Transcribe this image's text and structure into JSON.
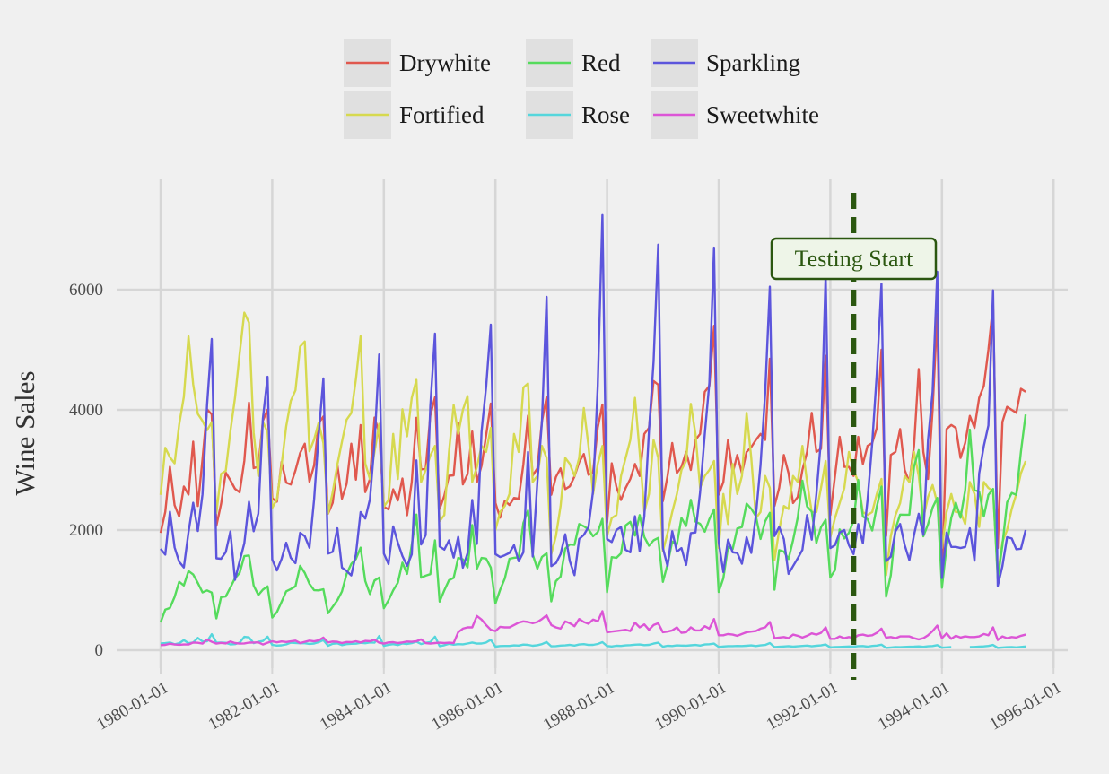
{
  "chart_data": {
    "type": "line",
    "title": "",
    "xlabel": "",
    "ylabel": "Wine Sales",
    "x_start": "1980-01-01",
    "frequency": "monthly",
    "xlim": [
      "1979-02-01",
      "1996-04-01"
    ],
    "ylim": [
      -300,
      7800
    ],
    "grid": true,
    "legend_position": "top",
    "x_ticks": [
      "1980-01-01",
      "1982-01-01",
      "1984-01-01",
      "1986-01-01",
      "1988-01-01",
      "1990-01-01",
      "1992-01-01",
      "1994-01-01",
      "1996-01-01"
    ],
    "y_ticks": [
      "0",
      "2000",
      "4000",
      "6000"
    ],
    "annotation": {
      "label": "Testing Start",
      "x": "1992-06-01",
      "style": "dashed vertical line"
    },
    "series": [
      {
        "name": "Drywhite",
        "color": "#e0584e",
        "values": [
          1954,
          2302,
          3054,
          2414,
          2226,
          2725,
          2589,
          3470,
          2400,
          3180,
          4009,
          3924,
          2072,
          2434,
          2956,
          2828,
          2687,
          2629,
          3150,
          4119,
          3030,
          3055,
          3821,
          4001,
          2529,
          2472,
          3134,
          2789,
          2758,
          2993,
          3282,
          3437,
          2804,
          3076,
          3782,
          3889,
          2271,
          2452,
          3084,
          2522,
          2769,
          3438,
          2839,
          3746,
          2632,
          2851,
          3871,
          3618,
          2389,
          2344,
          2678,
          2492,
          2858,
          2246,
          2800,
          3869,
          3007,
          3023,
          3907,
          4209,
          2353,
          2570,
          2903,
          2910,
          3782,
          2759,
          2931,
          3641,
          2794,
          3070,
          3576,
          4106,
          2452,
          2206,
          2488,
          2416,
          2534,
          2521,
          3093,
          3903,
          2907,
          3025,
          3812,
          4209,
          2587,
          2883,
          3027,
          2680,
          2729,
          2892,
          3131,
          3265,
          2919,
          2961,
          3705,
          4088,
          2120,
          3110,
          2720,
          2500,
          2700,
          2850,
          3100,
          2900,
          3600,
          3700,
          4480,
          4420,
          2480,
          2900,
          3450,
          2950,
          3050,
          3300,
          3000,
          3500,
          3600,
          4300,
          4400,
          5400,
          2590,
          2800,
          3500,
          2950,
          3250,
          2950,
          3300,
          3380,
          3500,
          3600,
          3500,
          4850,
          2400,
          2700,
          3250,
          2950,
          2450,
          2550,
          3000,
          3300,
          3950,
          3300,
          3350,
          4900,
          2250,
          2900,
          3550,
          3050,
          3050,
          2900,
          3550,
          3100,
          3400,
          3450,
          3700,
          5000,
          1900,
          3250,
          3300,
          3680,
          3000,
          2800,
          3400,
          4680,
          3300,
          2850,
          4000,
          5600,
          1200,
          3680,
          3750,
          3700,
          3200,
          3450,
          3900,
          3700,
          4200,
          4400,
          5000,
          5750,
          1700,
          3800,
          4050,
          4000,
          3950,
          4350,
          4300
        ]
      },
      {
        "name": "Fortified",
        "color": "#d6d94f",
        "values": [
          2585,
          3368,
          3210,
          3111,
          3756,
          4216,
          5225,
          4426,
          3932,
          3816,
          3661,
          3795,
          2285,
          2934,
          2985,
          3646,
          4198,
          4935,
          5618,
          5454,
          3624,
          2898,
          3802,
          3629,
          2369,
          2511,
          3079,
          3728,
          4151,
          4326,
          5054,
          5138,
          3310,
          3508,
          3790,
          3446,
          2275,
          2630,
          3089,
          3468,
          3837,
          3946,
          4514,
          5226,
          3110,
          2846,
          3300,
          3767,
          2388,
          2500,
          3600,
          2850,
          4010,
          3560,
          4200,
          4500,
          2800,
          3000,
          3240,
          3400,
          2150,
          2250,
          3300,
          4080,
          3600,
          4000,
          4230,
          2800,
          3050,
          3400,
          3300,
          3700,
          2000,
          2300,
          2400,
          2600,
          3600,
          3300,
          4370,
          4440,
          2800,
          2900,
          3400,
          3200,
          1600,
          1900,
          2400,
          3200,
          3100,
          2900,
          3200,
          4030,
          3400,
          2600,
          3100,
          3400,
          1900,
          2200,
          2250,
          2900,
          3200,
          3500,
          4200,
          3300,
          2300,
          2600,
          3500,
          3200,
          1650,
          1950,
          2300,
          2600,
          3000,
          3150,
          4100,
          3600,
          2700,
          2900,
          3000,
          3150,
          1700,
          2600,
          2100,
          3100,
          2600,
          2900,
          3950,
          3200,
          2200,
          2300,
          2900,
          2700,
          1500,
          2000,
          2400,
          2350,
          2900,
          2800,
          3400,
          2800,
          2300,
          2300,
          2700,
          3150,
          1880,
          2200,
          2450,
          2700,
          3300,
          3000,
          2800,
          2300,
          2250,
          2300,
          2600,
          2850,
          1250,
          1900,
          2250,
          2450,
          2900,
          2800,
          3300,
          2900,
          2200,
          2550,
          2750,
          2450,
          1700,
          2300,
          2600,
          2300,
          2300,
          2100,
          2800,
          2600,
          2050,
          2800,
          2700,
          2650,
          1250,
          1800,
          2000,
          2350,
          2600,
          2950,
          3150
        ]
      },
      {
        "name": "Red",
        "color": "#55db5c",
        "values": [
          464,
          675,
          703,
          887,
          1139,
          1077,
          1318,
          1260,
          1120,
          963,
          996,
          960,
          530,
          883,
          894,
          1045,
          1199,
          1287,
          1565,
          1577,
          1076,
          918,
          1008,
          1063,
          544,
          635,
          804,
          980,
          1018,
          1064,
          1404,
          1286,
          1104,
          999,
          996,
          1015,
          615,
          722,
          832,
          977,
          1270,
          1437,
          1520,
          1708,
          1151,
          934,
          1159,
          1209,
          699,
          830,
          996,
          1124,
          1458,
          1270,
          1753,
          2258,
          1208,
          1241,
          1265,
          1828,
          809,
          997,
          1164,
          1205,
          1538,
          1513,
          1378,
          2083,
          1357,
          1536,
          1526,
          1376,
          779,
          1005,
          1193,
          1522,
          1539,
          1546,
          2116,
          2326,
          1596,
          1356,
          1553,
          1613,
          814,
          1150,
          1225,
          1691,
          1759,
          1754,
          2100,
          2062,
          2012,
          1897,
          1964,
          2186,
          966,
          1549,
          1538,
          1612,
          2078,
          2137,
          1907,
          2249,
          1883,
          1739,
          1828,
          1868,
          1138,
          1430,
          1809,
          1763,
          2200,
          2067,
          2503,
          2141,
          2103,
          1972,
          2181,
          2344,
          970,
          1199,
          1718,
          1683,
          2025,
          2051,
          2439,
          2353,
          2230,
          1852,
          2147,
          2286,
          1007,
          1665,
          1642,
          1518,
          1831,
          2207,
          2822,
          2393,
          2306,
          1785,
          2047,
          2171,
          1212,
          1335,
          2011,
          1860,
          1954,
          2152,
          2835,
          2224,
          2182,
          1992,
          2389,
          2724,
          891,
          1247,
          2017,
          2257,
          2255,
          2255,
          3057,
          3330,
          1896,
          2096,
          2374,
          2535,
          1041,
          1728,
          2201,
          2455,
          2204,
          2660,
          3670,
          2665,
          2639,
          2226,
          2586,
          2684,
          1185,
          1749,
          2459,
          2618,
          2585,
          3310,
          3923
        ]
      },
      {
        "name": "Rose",
        "color": "#55d6dc",
        "values": [
          112,
          118,
          129,
          99,
          116,
          168,
          118,
          129,
          205,
          147,
          150,
          267,
          126,
          129,
          124,
          97,
          102,
          127,
          222,
          214,
          118,
          141,
          154,
          226,
          89,
          77,
          82,
          97,
          127,
          121,
          117,
          117,
          106,
          112,
          134,
          169,
          75,
          108,
          115,
          85,
          101,
          108,
          109,
          124,
          116,
          130,
          125,
          236,
          73,
          89,
          101,
          86,
          114,
          104,
          118,
          143,
          103,
          124,
          135,
          225,
          69,
          83,
          107,
          93,
          101,
          98,
          112,
          128,
          111,
          112,
          129,
          174,
          60,
          70,
          72,
          72,
          80,
          77,
          94,
          90,
          75,
          84,
          101,
          136,
          65,
          68,
          78,
          80,
          90,
          78,
          95,
          102,
          88,
          90,
          105,
          135,
          70,
          62,
          75,
          72,
          80,
          85,
          92,
          96,
          85,
          90,
          110,
          125,
          58,
          75,
          70,
          80,
          78,
          76,
          82,
          88,
          78,
          95,
          100,
          110,
          55,
          62,
          68,
          68,
          72,
          70,
          74,
          80,
          70,
          80,
          88,
          120,
          52,
          58,
          62,
          68,
          60,
          66,
          72,
          78,
          65,
          74,
          80,
          95,
          48,
          52,
          55,
          58,
          62,
          60,
          68,
          70,
          60,
          72,
          78,
          92,
          40,
          46,
          52,
          50,
          55,
          58,
          60,
          64,
          56,
          66,
          70,
          85,
          44,
          48,
          52,
          null,
          null,
          null,
          52,
          55,
          60,
          64,
          72,
          88,
          40,
          46,
          50,
          52,
          48,
          55,
          62
        ]
      },
      {
        "name": "Sparkling",
        "color": "#5c55dc",
        "values": [
          1686,
          1591,
          2304,
          1712,
          1471,
          1377,
          1966,
          2453,
          1984,
          2596,
          4087,
          5179,
          1530,
          1523,
          1633,
          1976,
          1170,
          1480,
          1781,
          2472,
          1981,
          2273,
          3857,
          4551,
          1510,
          1329,
          1518,
          1790,
          1537,
          1449,
          1954,
          1897,
          1706,
          2514,
          3593,
          4524,
          1609,
          1638,
          2030,
          1375,
          1320,
          1245,
          1600,
          2298,
          2191,
          2511,
          3440,
          4923,
          1609,
          1435,
          2061,
          1789,
          1567,
          1404,
          1597,
          3159,
          1759,
          1917,
          4062,
          5270,
          1725,
          1674,
          1828,
          1542,
          1887,
          1374,
          1617,
          2500,
          1770,
          3640,
          4380,
          5420,
          1600,
          1550,
          1580,
          1620,
          1750,
          1480,
          1630,
          3300,
          1560,
          2800,
          3800,
          5880,
          1400,
          1450,
          1600,
          1930,
          1480,
          1250,
          1850,
          1920,
          2050,
          2650,
          4400,
          7242,
          1850,
          1800,
          2000,
          2050,
          1670,
          1630,
          2230,
          1650,
          2230,
          3650,
          4800,
          6750,
          1700,
          1400,
          1980,
          1640,
          1700,
          1420,
          1950,
          1960,
          2630,
          3600,
          4450,
          6700,
          1800,
          1300,
          1840,
          1630,
          1620,
          1440,
          1880,
          1620,
          2250,
          3080,
          4280,
          6050,
          1900,
          2050,
          1850,
          1270,
          1400,
          1530,
          1670,
          2250,
          1840,
          2600,
          3500,
          6250,
          1700,
          1750,
          1960,
          2000,
          1750,
          1600,
          2100,
          1780,
          2500,
          3450,
          4600,
          6100,
          1480,
          1560,
          1980,
          2100,
          1750,
          1500,
          1920,
          2270,
          1920,
          3500,
          4300,
          6300,
          1200,
          1960,
          1720,
          1720,
          1700,
          1720,
          2030,
          1490,
          2940,
          3400,
          3740,
          5990,
          1070,
          1400,
          1880,
          1860,
          1680,
          1690,
          2000
        ]
      },
      {
        "name": "Sweetwhite",
        "color": "#dc55d6",
        "values": [
          85,
          89,
          109,
          95,
          91,
          95,
          96,
          128,
          124,
          111,
          178,
          140,
          110,
          123,
          114,
          145,
          120,
          111,
          113,
          127,
          128,
          131,
          95,
          125,
          150,
          132,
          146,
          138,
          148,
          160,
          120,
          140,
          160,
          148,
          165,
          210,
          130,
          145,
          140,
          120,
          138,
          135,
          150,
          130,
          155,
          150,
          175,
          125,
          110,
          130,
          135,
          120,
          130,
          145,
          140,
          150,
          180,
          120,
          110,
          120,
          125,
          120,
          125,
          120,
          300,
          360,
          380,
          380,
          570,
          510,
          420,
          340,
          320,
          390,
          380,
          380,
          420,
          460,
          480,
          470,
          450,
          470,
          520,
          580,
          420,
          380,
          360,
          480,
          450,
          400,
          520,
          470,
          440,
          510,
          480,
          650,
          300,
          310,
          320,
          330,
          340,
          320,
          460,
          380,
          430,
          340,
          420,
          450,
          300,
          310,
          330,
          380,
          290,
          300,
          380,
          330,
          330,
          400,
          360,
          520,
          250,
          250,
          270,
          260,
          240,
          270,
          300,
          310,
          320,
          360,
          380,
          470,
          200,
          210,
          220,
          200,
          260,
          240,
          210,
          240,
          280,
          260,
          290,
          380,
          190,
          190,
          230,
          200,
          220,
          200,
          250,
          260,
          240,
          250,
          290,
          360,
          210,
          220,
          200,
          230,
          230,
          230,
          200,
          180,
          200,
          250,
          320,
          410,
          200,
          280,
          190,
          240,
          210,
          230,
          220,
          220,
          230,
          270,
          250,
          380,
          170,
          230,
          200,
          220,
          210,
          240,
          260
        ]
      }
    ]
  }
}
